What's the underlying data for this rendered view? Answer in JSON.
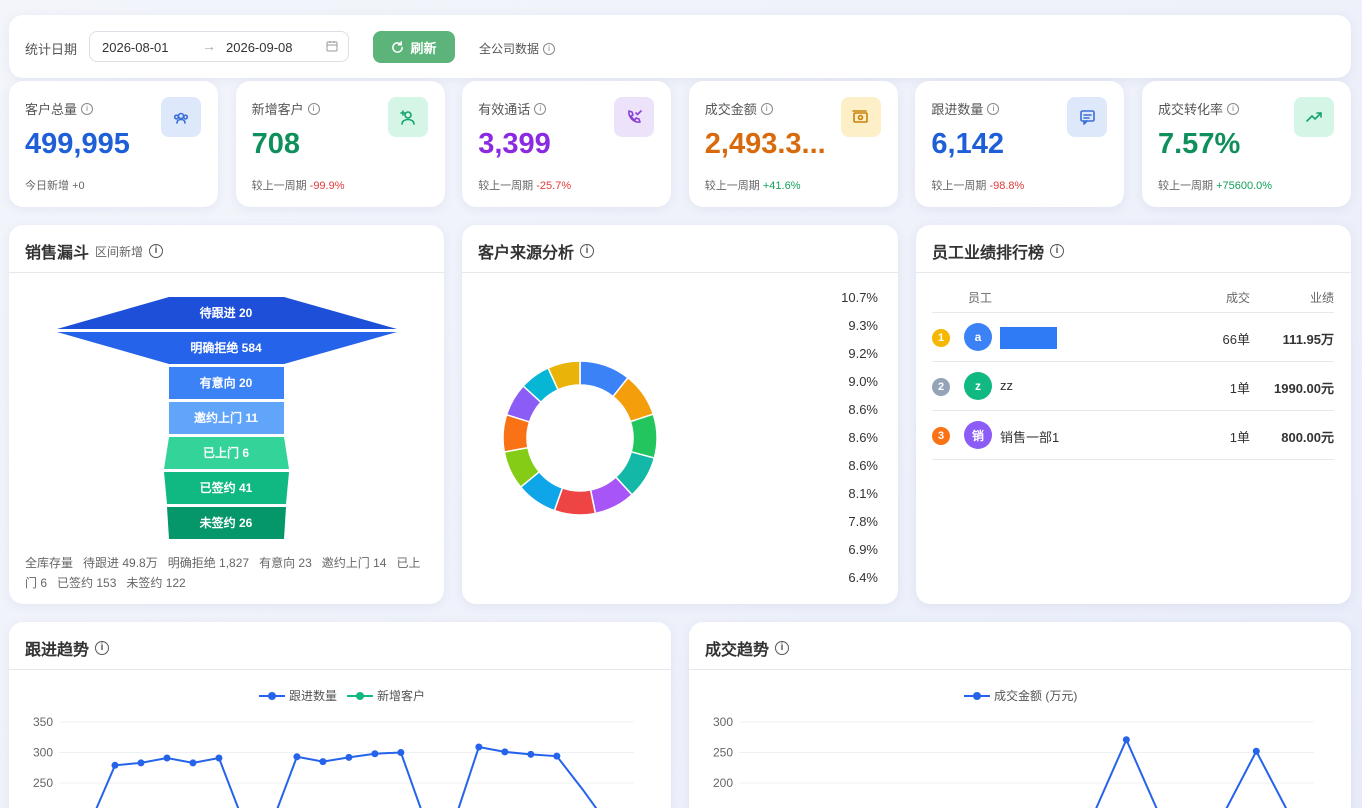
{
  "toolbar": {
    "date_label": "统计日期",
    "start_date": "2026-08-01",
    "end_date": "2026-09-08",
    "refresh_label": "刷新",
    "scope_label": "全公司数据"
  },
  "stats": [
    {
      "title": "客户总量",
      "value": "499,995",
      "sub_label": "今日新增",
      "sub_value": "+0",
      "color": "#1e5fd8",
      "icon": "users-icon",
      "icon_bg": "#dde8fb",
      "icon_color": "#3a6fd8"
    },
    {
      "title": "新增客户",
      "value": "708",
      "sub_label": "较上一周期",
      "sub_value": "-99.9%",
      "color": "#0f8f5b",
      "icon": "user-add-icon",
      "icon_bg": "#d5f5e6",
      "icon_color": "#16a46a"
    },
    {
      "title": "有效通话",
      "value": "3,399",
      "sub_label": "较上一周期",
      "sub_value": "-25.7%",
      "color": "#8a2be2",
      "icon": "phone-check-icon",
      "icon_bg": "#ece3fb",
      "icon_color": "#8b3fd9"
    },
    {
      "title": "成交金额",
      "value": "2,493.3...",
      "sub_label": "较上一周期",
      "sub_value": "+41.6%",
      "color": "#d86a0c",
      "icon": "money-icon",
      "icon_bg": "#fdf0c8",
      "icon_color": "#c9820c"
    },
    {
      "title": "跟进数量",
      "value": "6,142",
      "sub_label": "较上一周期",
      "sub_value": "-98.8%",
      "color": "#1e5fd8",
      "icon": "message-icon",
      "icon_bg": "#dde8fb",
      "icon_color": "#3a6fd8"
    },
    {
      "title": "成交转化率",
      "value": "7.57%",
      "sub_label": "较上一周期",
      "sub_value": "+75600.0%",
      "color": "#0f8f5b",
      "icon": "trend-up-icon",
      "icon_bg": "#d5f5e6",
      "icon_color": "#16a46a"
    }
  ],
  "funnel": {
    "title": "销售漏斗",
    "subtitle": "区间新增",
    "stages": [
      {
        "label": "待跟进",
        "value": "20",
        "color": "#1d4fd8"
      },
      {
        "label": "明确拒绝",
        "value": "584",
        "color": "#2563eb"
      },
      {
        "label": "有意向",
        "value": "20",
        "color": "#3b82f6"
      },
      {
        "label": "邀约上门",
        "value": "11",
        "color": "#60a5fa"
      },
      {
        "label": "已上门",
        "value": "6",
        "color": "#34d399"
      },
      {
        "label": "已签约",
        "value": "41",
        "color": "#10b981"
      },
      {
        "label": "未签约",
        "value": "26",
        "color": "#059669"
      }
    ],
    "footer": [
      {
        "label": "全库存量",
        "value": ""
      },
      {
        "label": "待跟进",
        "value": "49.8万"
      },
      {
        "label": "明确拒绝",
        "value": "1,827"
      },
      {
        "label": "有意向",
        "value": "23"
      },
      {
        "label": "邀约上门",
        "value": "14"
      },
      {
        "label": "已上门",
        "value": "6"
      },
      {
        "label": "已签约",
        "value": "153"
      },
      {
        "label": "未签约",
        "value": "122"
      }
    ]
  },
  "source": {
    "title": "客户来源分析",
    "chart_data": {
      "type": "pie",
      "values": [
        10.7,
        9.3,
        9.2,
        9.0,
        8.6,
        8.6,
        8.6,
        8.1,
        7.8,
        6.9,
        6.4,
        6.8
      ],
      "labels": [
        "10.7%",
        "9.3%",
        "9.2%",
        "9.0%",
        "8.6%",
        "8.6%",
        "8.6%",
        "8.1%",
        "7.8%",
        "6.9%",
        "6.4%"
      ],
      "colors": [
        "#3b82f6",
        "#f59e0b",
        "#22c55e",
        "#14b8a6",
        "#a855f7",
        "#ef4444",
        "#0ea5e9",
        "#84cc16",
        "#f97316",
        "#8b5cf6",
        "#06b6d4",
        "#eab308"
      ]
    }
  },
  "rank": {
    "title": "员工业绩排行榜",
    "col_employee": "员工",
    "col_deals": "成交",
    "col_amount": "业绩",
    "rows": [
      {
        "rank": "1",
        "avatar": "a",
        "name": "",
        "deals": "66单",
        "amount": "111.95万",
        "rank_color": "#f5b800",
        "avatar_color": "#3b82f6"
      },
      {
        "rank": "2",
        "avatar": "z",
        "name": "zz",
        "deals": "1单",
        "amount": "1990.00元",
        "rank_color": "#94a3b8",
        "avatar_color": "#10b981"
      },
      {
        "rank": "3",
        "avatar": "销",
        "name": "销售一部1",
        "deals": "1单",
        "amount": "800.00元",
        "rank_color": "#f97316",
        "avatar_color": "#8b5cf6"
      }
    ]
  },
  "trend_follow": {
    "title": "跟进趋势",
    "chart_data": {
      "type": "line",
      "legend": [
        "跟进数量",
        "新增客户"
      ],
      "y_ticks": [
        "350",
        "300",
        "250"
      ],
      "ylim": [
        200,
        350
      ],
      "series": [
        {
          "name": "跟进数量",
          "color": "#2563eb",
          "values": [
            180,
            279,
            283,
            291,
            283,
            291,
            180,
            180,
            293,
            285,
            292,
            298,
            300,
            180,
            180,
            309,
            301,
            297,
            294,
            239,
            180
          ]
        },
        {
          "name": "新增客户",
          "color": "#10b981",
          "values": []
        }
      ]
    }
  },
  "trend_deal": {
    "title": "成交趋势",
    "chart_data": {
      "type": "line",
      "legend": [
        "成交金额 (万元)"
      ],
      "y_ticks": [
        "300",
        "250",
        "200"
      ],
      "ylim": [
        150,
        300
      ],
      "series": [
        {
          "name": "成交金额 (万元)",
          "color": "#2563eb",
          "values": [
            150,
            150,
            150,
            150,
            150,
            150,
            150,
            150,
            150,
            150,
            150,
            271,
            150,
            150,
            150,
            252,
            150
          ]
        }
      ]
    }
  }
}
